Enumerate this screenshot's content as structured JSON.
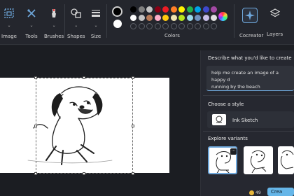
{
  "ribbon": {
    "tools": [
      {
        "label": "Image",
        "icon": "image-select-icon"
      },
      {
        "label": "Tools",
        "icon": "tools-icon"
      },
      {
        "label": "Brushes",
        "icon": "brush-icon"
      },
      {
        "label": "Shapes",
        "icon": "shapes-icon"
      },
      {
        "label": "Size",
        "icon": "size-icon"
      },
      {
        "label": "Colors",
        "icon": "palette-icon"
      },
      {
        "label": "Cocreator",
        "icon": "cocreator-icon"
      },
      {
        "label": "Layers",
        "icon": "layers-icon"
      }
    ],
    "primary_color": "#000000",
    "secondary_color": "#ffffff",
    "palette_row1": [
      "#000000",
      "#7f7f7f",
      "#c3c3c3",
      "#880015",
      "#ed1c24",
      "#ff7f27",
      "#fff200",
      "#22b14c",
      "#00a2e8",
      "#3f48cc",
      "#a349a4"
    ],
    "palette_row2": [
      "#ffffff",
      "#c3c3c3",
      "#b97a57",
      "#ffaec9",
      "#ffc90e",
      "#efe4b0",
      "#b5e61d",
      "#99d9ea",
      "#7092be",
      "#c8bfe7",
      "#e0e0e0"
    ]
  },
  "panel": {
    "describe_title": "Describe what you'd like to create",
    "prompt_line1": "help me create an image of a happy d",
    "prompt_line2": "running by the beach",
    "style_title": "Choose a style",
    "style_name": "Ink Sketch",
    "variants_title": "Explore variants",
    "credits": "49",
    "create_label": "Crea"
  }
}
